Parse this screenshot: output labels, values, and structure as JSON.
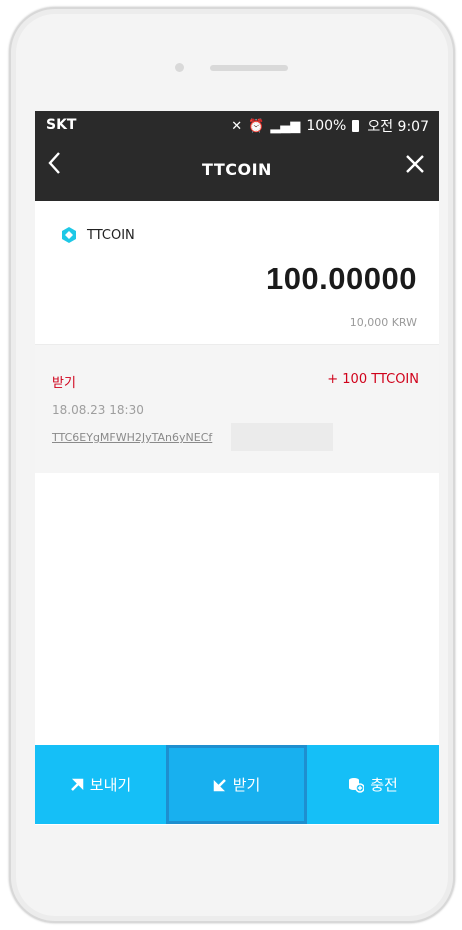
{
  "status_bar": {
    "carrier": "SKT",
    "battery": "100%",
    "time": "오전 9:07"
  },
  "app_bar": {
    "title": "TTCOIN"
  },
  "coin": {
    "name": "TTCOIN",
    "balance": "100.00000",
    "fiat_value": "10,000 KRW"
  },
  "transaction": {
    "type": "받기",
    "amount": "+ 100 TTCOIN",
    "datetime": "18.08.23 18:30",
    "address": "TTC6EYgMFWH2JyTAn6yNECf"
  },
  "bottom_tabs": {
    "send": "보내기",
    "receive": "받기",
    "charge": "충전"
  },
  "colors": {
    "accent": "#15bff7",
    "header": "#2a2a2a",
    "received": "#d0021b"
  }
}
